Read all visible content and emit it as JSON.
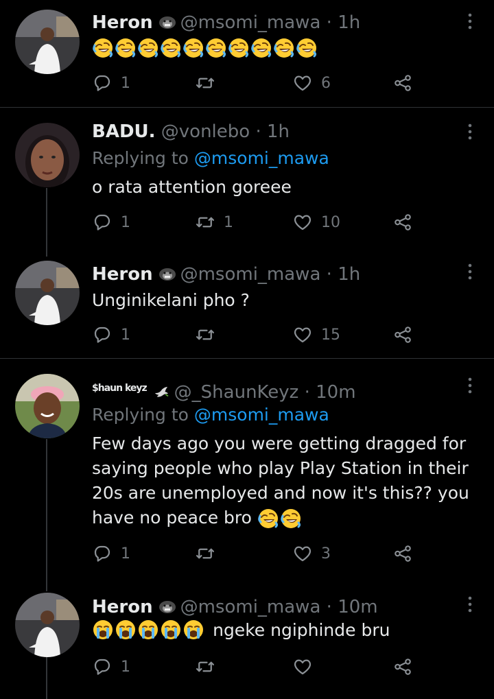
{
  "tweets": [
    {
      "name": "Heron",
      "handle": "@msomi_mawa",
      "dot": "·",
      "time": "1h",
      "replying_prefix": "",
      "replying_to": "",
      "text": "",
      "emoji_count": 10,
      "emoji": "rofl",
      "replies": "1",
      "retweets": "",
      "likes": "6"
    },
    {
      "name": "BADU.",
      "handle": "@vonlebo",
      "dot": "·",
      "time": "1h",
      "replying_prefix": "Replying to",
      "replying_to": "@msomi_mawa",
      "text": "o rata attention goreee",
      "replies": "1",
      "retweets": "1",
      "likes": "10"
    },
    {
      "name": "Heron",
      "handle": "@msomi_mawa",
      "dot": "·",
      "time": "1h",
      "text": "Unginikelani pho ?",
      "replies": "1",
      "retweets": "",
      "likes": "15"
    },
    {
      "name": "$haun keyz",
      "handle": "@_ShaunKeyz",
      "dot": "·",
      "time": "10m",
      "replying_prefix": "Replying to",
      "replying_to": "@msomi_mawa",
      "text": "Few days ago you were getting dragged for saying people who play Play Station in their 20s are unemployed and now it's this?? you have no peace bro",
      "trailing_emoji": "rofl",
      "trailing_emoji_count": 2,
      "replies": "1",
      "retweets": "",
      "likes": "3"
    },
    {
      "name": "Heron",
      "handle": "@msomi_mawa",
      "dot": "·",
      "time": "10m",
      "emoji": "sob",
      "emoji_count": 5,
      "text": "ngeke ngiphinde bru",
      "replies": "1",
      "retweets": "",
      "likes": ""
    }
  ],
  "icons": [
    "reply-icon",
    "retweet-icon",
    "like-icon",
    "share-icon",
    "more-icon",
    "gorilla-icon",
    "dove-icon",
    "rofl-emoji",
    "sob-emoji"
  ],
  "colors": {
    "background": "#000000",
    "muted": "#71767b",
    "link": "#1d9bf0",
    "separator": "#2f3336"
  }
}
